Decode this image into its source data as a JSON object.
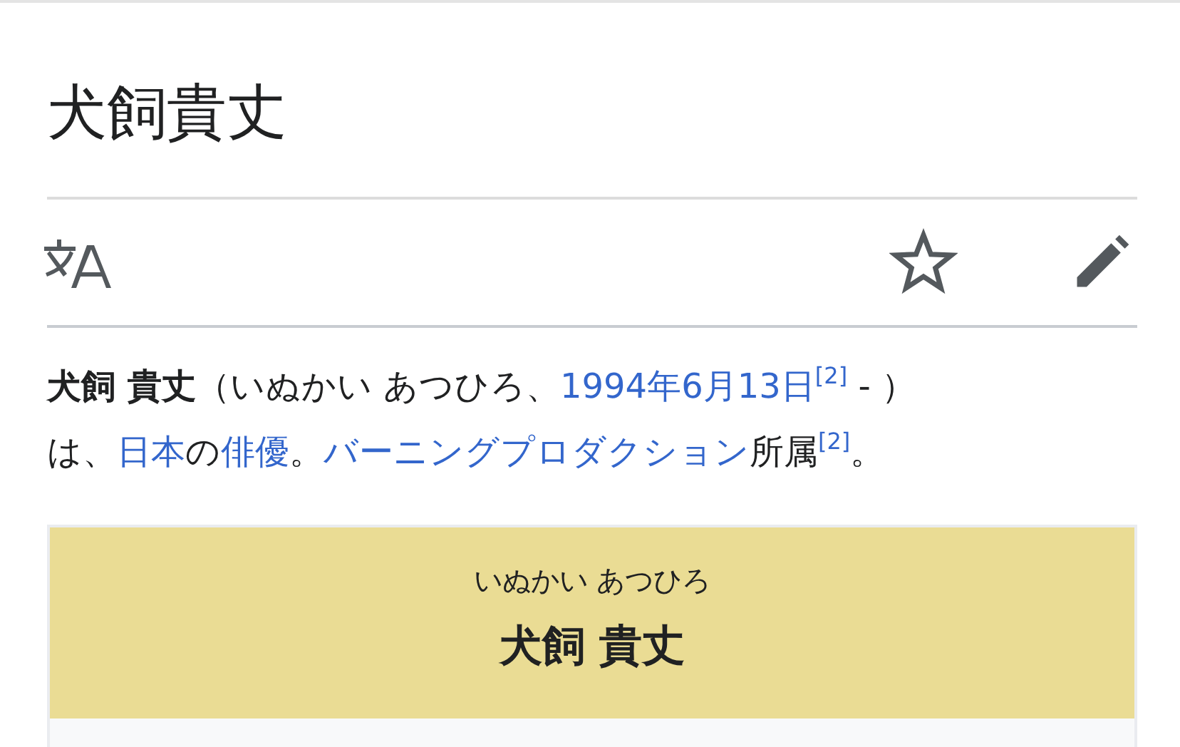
{
  "page_title": "犬飼貴丈",
  "lead": {
    "lines": [
      [
        {
          "kind": "bold",
          "text": "犬飼 貴丈"
        },
        {
          "kind": "text",
          "text": "（いぬかい あつひろ、"
        },
        {
          "kind": "link",
          "text": "1994年6月13日"
        },
        {
          "kind": "ref",
          "text": "[2]"
        },
        {
          "kind": "text",
          "text": " - ）"
        }
      ],
      [
        {
          "kind": "text",
          "text": "は、"
        },
        {
          "kind": "link",
          "text": "日本"
        },
        {
          "kind": "text",
          "text": "の"
        },
        {
          "kind": "link",
          "text": "俳優"
        },
        {
          "kind": "text",
          "text": "。"
        },
        {
          "kind": "link",
          "text": "バーニングプロダクション"
        },
        {
          "kind": "text",
          "text": "所属"
        },
        {
          "kind": "ref",
          "text": "[2]"
        },
        {
          "kind": "text",
          "text": "。"
        }
      ]
    ]
  },
  "infobox": {
    "reading": "いぬかい あつひろ",
    "name": "犬飼 貴丈"
  }
}
